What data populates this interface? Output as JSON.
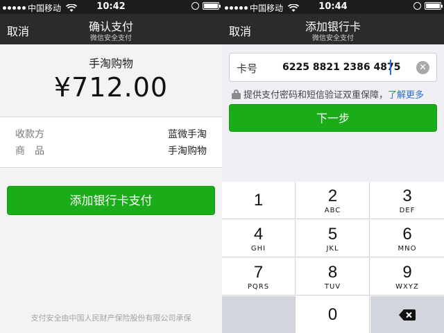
{
  "left_screen": {
    "status": {
      "carrier": "中国移动",
      "time": "10:42"
    },
    "navbar": {
      "cancel": "取消",
      "title": "确认支付",
      "subtitle": "微信安全支付"
    },
    "merchant_title": "手淘购物",
    "amount": "¥712.00",
    "info": [
      {
        "key": "收款方",
        "value": "蓝微手淘"
      },
      {
        "key": "商　品",
        "value": "手淘购物"
      }
    ],
    "pay_button": "添加银行卡支付",
    "footer": "支付安全由中国人民财产保险股份有限公司承保"
  },
  "right_screen": {
    "status": {
      "carrier": "中国移动",
      "time": "10:44"
    },
    "navbar": {
      "cancel": "取消",
      "title": "添加银行卡",
      "subtitle": "微信安全支付"
    },
    "card_field": {
      "label": "卡号",
      "value": "6225 8821 2386 4875"
    },
    "guarantee": {
      "text": "提供支付密码和短信验证双重保障，",
      "link": "了解更多"
    },
    "next_button": "下一步",
    "keypad": [
      {
        "num": "1",
        "letters": ""
      },
      {
        "num": "2",
        "letters": "ABC"
      },
      {
        "num": "3",
        "letters": "DEF"
      },
      {
        "num": "4",
        "letters": "GHI"
      },
      {
        "num": "5",
        "letters": "JKL"
      },
      {
        "num": "6",
        "letters": "MNO"
      },
      {
        "num": "7",
        "letters": "PQRS"
      },
      {
        "num": "8",
        "letters": "TUV"
      },
      {
        "num": "9",
        "letters": "WXYZ"
      },
      {
        "num": "0",
        "letters": ""
      }
    ]
  },
  "colors": {
    "accent_green": "#1aad19",
    "navbar": "#2b2b2b",
    "link_blue": "#2a6fd8"
  },
  "icons": [
    "signal-icon",
    "wifi-icon",
    "clock-icon",
    "battery-icon",
    "lock-icon",
    "clear-icon",
    "backspace-icon"
  ]
}
